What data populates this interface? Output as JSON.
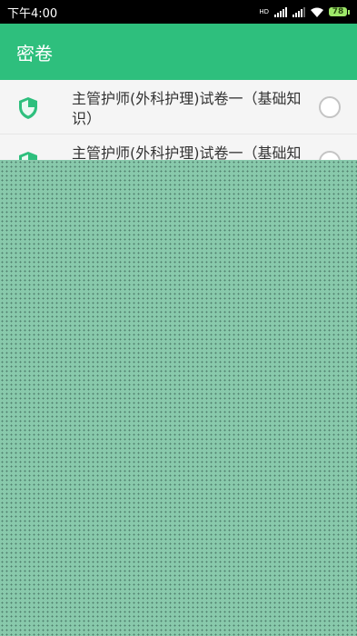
{
  "status_bar": {
    "time": "下午4:00",
    "network_label": "HD",
    "battery_level": "78"
  },
  "app_bar": {
    "title": "密卷"
  },
  "list": {
    "items": [
      {
        "label": "主管护师(外科护理)试卷一（基础知识）",
        "icon": "shield-check-icon",
        "selected": false
      },
      {
        "label": "主管护师(外科护理)试卷一（基础知识）",
        "icon": "shield-check-icon",
        "selected": false
      }
    ]
  },
  "colors": {
    "primary": "#2ebf7d",
    "overlay": "#88c9ab",
    "status_bar": "#000000"
  }
}
